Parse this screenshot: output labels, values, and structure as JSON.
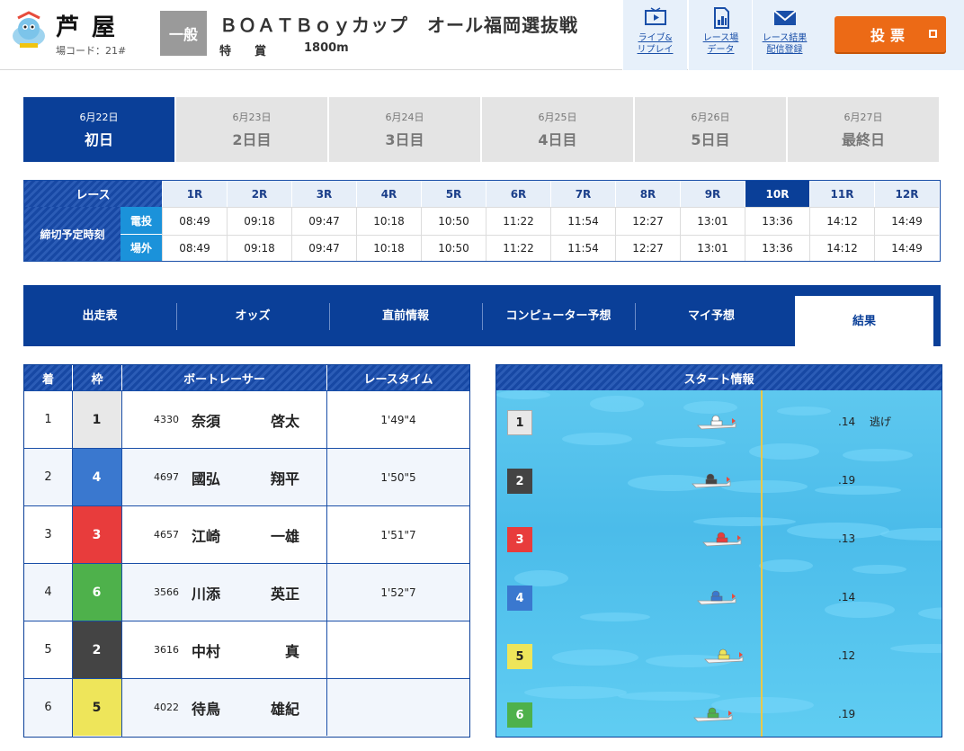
{
  "header": {
    "venue": "芦屋",
    "venue_code": "場コード：21#",
    "grade": "一般",
    "race_title": "ＢＯＡＴＢｏｙカップ　オール福岡選抜戦",
    "race_subtitle": "特　　賞",
    "distance": "1800m",
    "buttons": [
      {
        "label1": "ライブ&",
        "label2": "リプレイ",
        "icon": "tv-icon"
      },
      {
        "label1": "レース場",
        "label2": "データ",
        "icon": "chart-doc-icon"
      },
      {
        "label1": "レース結果",
        "label2": "配信登録",
        "icon": "mail-icon"
      }
    ],
    "vote_label": "投票"
  },
  "day_tabs": [
    {
      "date": "6月22日",
      "name": "初日",
      "active": true
    },
    {
      "date": "6月23日",
      "name": "2日目",
      "active": false
    },
    {
      "date": "6月24日",
      "name": "3日目",
      "active": false
    },
    {
      "date": "6月25日",
      "name": "4日目",
      "active": false
    },
    {
      "date": "6月26日",
      "name": "5日目",
      "active": false
    },
    {
      "date": "6月27日",
      "name": "最終日",
      "active": false
    }
  ],
  "schedule": {
    "race_label": "レース",
    "deadline_label": "締切予定時刻",
    "row_labels": [
      "電投",
      "場外"
    ],
    "races": [
      "1R",
      "2R",
      "3R",
      "4R",
      "5R",
      "6R",
      "7R",
      "8R",
      "9R",
      "10R",
      "11R",
      "12R"
    ],
    "active_race": "10R",
    "times_denpyo": [
      "08:49",
      "09:18",
      "09:47",
      "10:18",
      "10:50",
      "11:22",
      "11:54",
      "12:27",
      "13:01",
      "13:36",
      "14:12",
      "14:49"
    ],
    "times_jogai": [
      "08:49",
      "09:18",
      "09:47",
      "10:18",
      "10:50",
      "11:22",
      "11:54",
      "12:27",
      "13:01",
      "13:36",
      "14:12",
      "14:49"
    ]
  },
  "menu": {
    "items": [
      "出走表",
      "オッズ",
      "直前情報",
      "コンピューター\n予想",
      "マイ予想",
      "結果"
    ],
    "active": "結果"
  },
  "results": {
    "headers": [
      "着",
      "枠",
      "ボートレーサー",
      "レースタイム"
    ],
    "rows": [
      {
        "rank": "1",
        "frame": "1",
        "number": "4330",
        "last": "奈須",
        "first": "啓太",
        "time": "1'49\"4"
      },
      {
        "rank": "2",
        "frame": "4",
        "number": "4697",
        "last": "國弘",
        "first": "翔平",
        "time": "1'50\"5"
      },
      {
        "rank": "3",
        "frame": "3",
        "number": "4657",
        "last": "江崎",
        "first": "一雄",
        "time": "1'51\"7"
      },
      {
        "rank": "4",
        "frame": "6",
        "number": "3566",
        "last": "川添",
        "first": "英正",
        "time": "1'52\"7"
      },
      {
        "rank": "5",
        "frame": "2",
        "number": "3616",
        "last": "中村",
        "first": "真",
        "time": ""
      },
      {
        "rank": "6",
        "frame": "5",
        "number": "4022",
        "last": "待鳥",
        "first": "雄紀",
        "time": ""
      }
    ]
  },
  "start_info": {
    "title": "スタート情報",
    "lanes": [
      {
        "lane": "1",
        "st": ".14",
        "kimarite": "逃げ"
      },
      {
        "lane": "2",
        "st": ".19",
        "kimarite": ""
      },
      {
        "lane": "3",
        "st": ".13",
        "kimarite": ""
      },
      {
        "lane": "4",
        "st": ".14",
        "kimarite": ""
      },
      {
        "lane": "5",
        "st": ".12",
        "kimarite": ""
      },
      {
        "lane": "6",
        "st": ".19",
        "kimarite": ""
      }
    ]
  },
  "colors": {
    "navy": "#0a3f98",
    "frame_colors": {
      "1": "#e8e8e8",
      "2": "#444444",
      "3": "#e83c3c",
      "4": "#3a78cf",
      "5": "#eee55a",
      "6": "#4eb14b"
    },
    "frame_text": {
      "1": "#222222",
      "2": "#ffffff",
      "3": "#ffffff",
      "4": "#ffffff",
      "5": "#222222",
      "6": "#ffffff"
    },
    "vote": "#ec6a16"
  }
}
